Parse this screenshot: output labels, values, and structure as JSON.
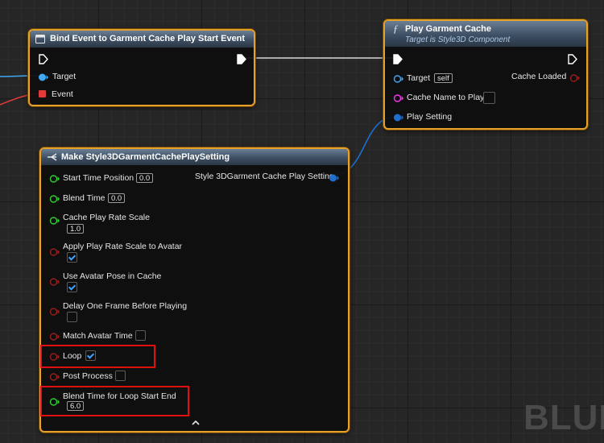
{
  "bind_node": {
    "title": "Bind Event to Garment Cache Play Start Event",
    "pins": {
      "target": "Target",
      "event": "Event"
    }
  },
  "play_node": {
    "title": "Play Garment Cache",
    "subtitle": "Target is Style3D Component",
    "function_icon": "ƒ",
    "pins": {
      "target": "Target",
      "target_value": "self",
      "cache_loaded": "Cache Loaded",
      "cache_name": "Cache Name to Play",
      "play_setting": "Play Setting"
    }
  },
  "make_node": {
    "title": "Make Style3DGarmentCachePlaySetting",
    "output": "Style 3DGarment Cache Play Setting",
    "fields": {
      "start_time": {
        "label": "Start Time Position",
        "value": "0.0"
      },
      "blend_time": {
        "label": "Blend Time",
        "value": "0.0"
      },
      "cache_rate": {
        "label": "Cache Play Rate Scale",
        "value": "1.0"
      },
      "apply_rate": {
        "label": "Apply Play Rate Scale to Avatar",
        "checked": true
      },
      "avatar_pose": {
        "label": "Use Avatar Pose in Cache",
        "checked": true
      },
      "delay_frame": {
        "label": "Delay One Frame Before Playing",
        "checked": false
      },
      "match_time": {
        "label": "Match Avatar Time",
        "checked": false
      },
      "loop": {
        "label": "Loop",
        "checked": true
      },
      "post_process": {
        "label": "Post Process",
        "checked": false
      },
      "loop_blend": {
        "label": "Blend Time for Loop Start End",
        "value": "6.0"
      }
    }
  },
  "colors": {
    "node_border": "#e7a12b",
    "exec_pin": "#ffffff",
    "object_pin": "#3fa9f5",
    "delegate_pin": "#e03a3a",
    "float_pin": "#2fcf2f",
    "bool_pin": "#9b1d1d",
    "string_pin": "#ff33ff",
    "struct_pin": "#1f6fd0",
    "highlight": "#e01010"
  },
  "watermark": "BLUE"
}
